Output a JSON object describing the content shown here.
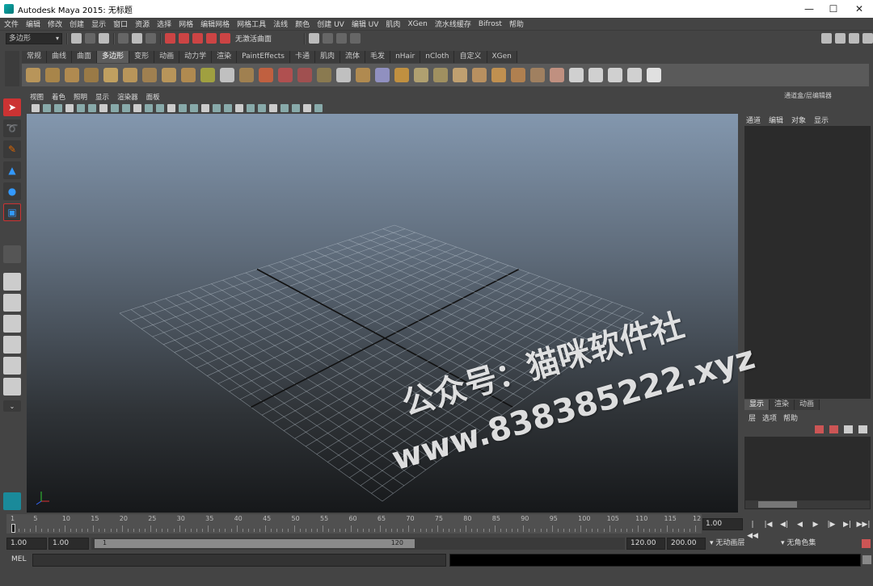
{
  "window": {
    "title": "Autodesk Maya 2015: 无标题",
    "minimize": "—",
    "maximize": "☐",
    "close": "✕"
  },
  "menubar": [
    "文件",
    "编辑",
    "修改",
    "创建",
    "显示",
    "窗口",
    "资源",
    "选择",
    "网格",
    "编辑网格",
    "网格工具",
    "法线",
    "颜色",
    "创建 UV",
    "编辑 UV",
    "肌肉",
    "XGen",
    "流水线缓存",
    "Bifrost",
    "帮助"
  ],
  "statusline": {
    "mode": "多边形",
    "live_surface": "无激活曲面"
  },
  "shelf": {
    "tabs": [
      "常规",
      "曲线",
      "曲面",
      "多边形",
      "变形",
      "动画",
      "动力学",
      "渲染",
      "PaintEffects",
      "卡通",
      "肌肉",
      "流体",
      "毛发",
      "nHair",
      "nCloth",
      "自定义",
      "XGen"
    ],
    "active_tab": 3
  },
  "panel": {
    "menu": [
      "视图",
      "着色",
      "照明",
      "显示",
      "渲染器",
      "面板"
    ]
  },
  "channel_box": {
    "header": "通道盒/层编辑器",
    "menu": [
      "通道",
      "编辑",
      "对象",
      "显示"
    ]
  },
  "layer_editor": {
    "tabs": [
      "显示",
      "渲染",
      "动画"
    ],
    "active_tab": 0,
    "menu": [
      "层",
      "选项",
      "帮助"
    ]
  },
  "time_slider": {
    "start": 1,
    "end": 120,
    "current": 1,
    "tick_labels": [
      "1",
      "5",
      "10",
      "15",
      "20",
      "25",
      "30",
      "35",
      "40",
      "45",
      "50",
      "55",
      "60",
      "65",
      "70",
      "75",
      "80",
      "85",
      "90",
      "95",
      "100",
      "105",
      "110",
      "115",
      "12"
    ],
    "current_frame": "1.00"
  },
  "playback": [
    "|◀◀",
    "|◀",
    "◀|",
    "◀",
    "▶",
    "|▶",
    "▶|",
    "▶▶|"
  ],
  "range": {
    "start_time": "1.00",
    "playback_start": "1.00",
    "slider_start": "1",
    "slider_end": "120",
    "playback_end": "120.00",
    "end_time": "200.00",
    "anim_layer": "无动画层",
    "character_set": "无角色集"
  },
  "command_line": {
    "label": "MEL"
  },
  "watermark": {
    "line1": "公众号：猫咪软件社",
    "line2": "www.838385222.xyz"
  }
}
